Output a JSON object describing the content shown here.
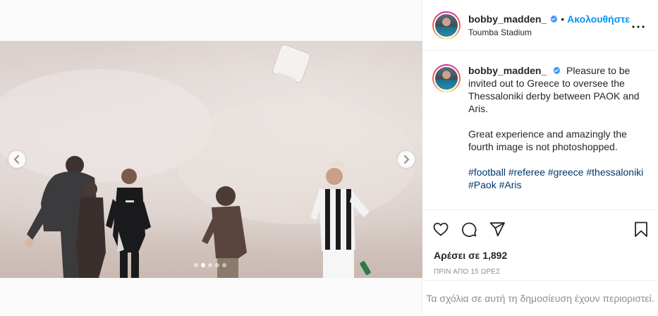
{
  "post": {
    "username": "bobby_madden_",
    "separator": "•",
    "follow_label": "Ακολουθήστε",
    "location": "Toumba Stadium",
    "verified": true
  },
  "caption": {
    "username": "bobby_madden_",
    "line1": "Pleasure to be invited out to Greece to oversee the Thessaloniki derby between PAOK and Aris.",
    "line2": "Great experience and amazingly the fourth image is not photoshopped.",
    "hashtags": [
      "#football",
      "#referee",
      "#greece",
      "#thessaloniki",
      "#Paok",
      "#Aris"
    ]
  },
  "engagement": {
    "likes_text": "Αρέσει σε 1,892",
    "timestamp": "ΠΡΙΝ ΑΠΟ 15 ΩΡΕΣ"
  },
  "comments": {
    "restricted_text": "Τα σχόλια σε αυτή τη δημοσίευση έχουν περιοριστεί."
  },
  "carousel": {
    "slide_count": 5,
    "active_index": 1
  },
  "colors": {
    "accent": "#0095f6",
    "hashtag": "#00376b",
    "muted": "#8e8e8e",
    "text": "#262626"
  },
  "icons": [
    "chevron-left-icon",
    "chevron-right-icon",
    "verified-badge-icon",
    "more-options-icon",
    "heart-icon",
    "comment-icon",
    "share-icon",
    "bookmark-icon"
  ]
}
